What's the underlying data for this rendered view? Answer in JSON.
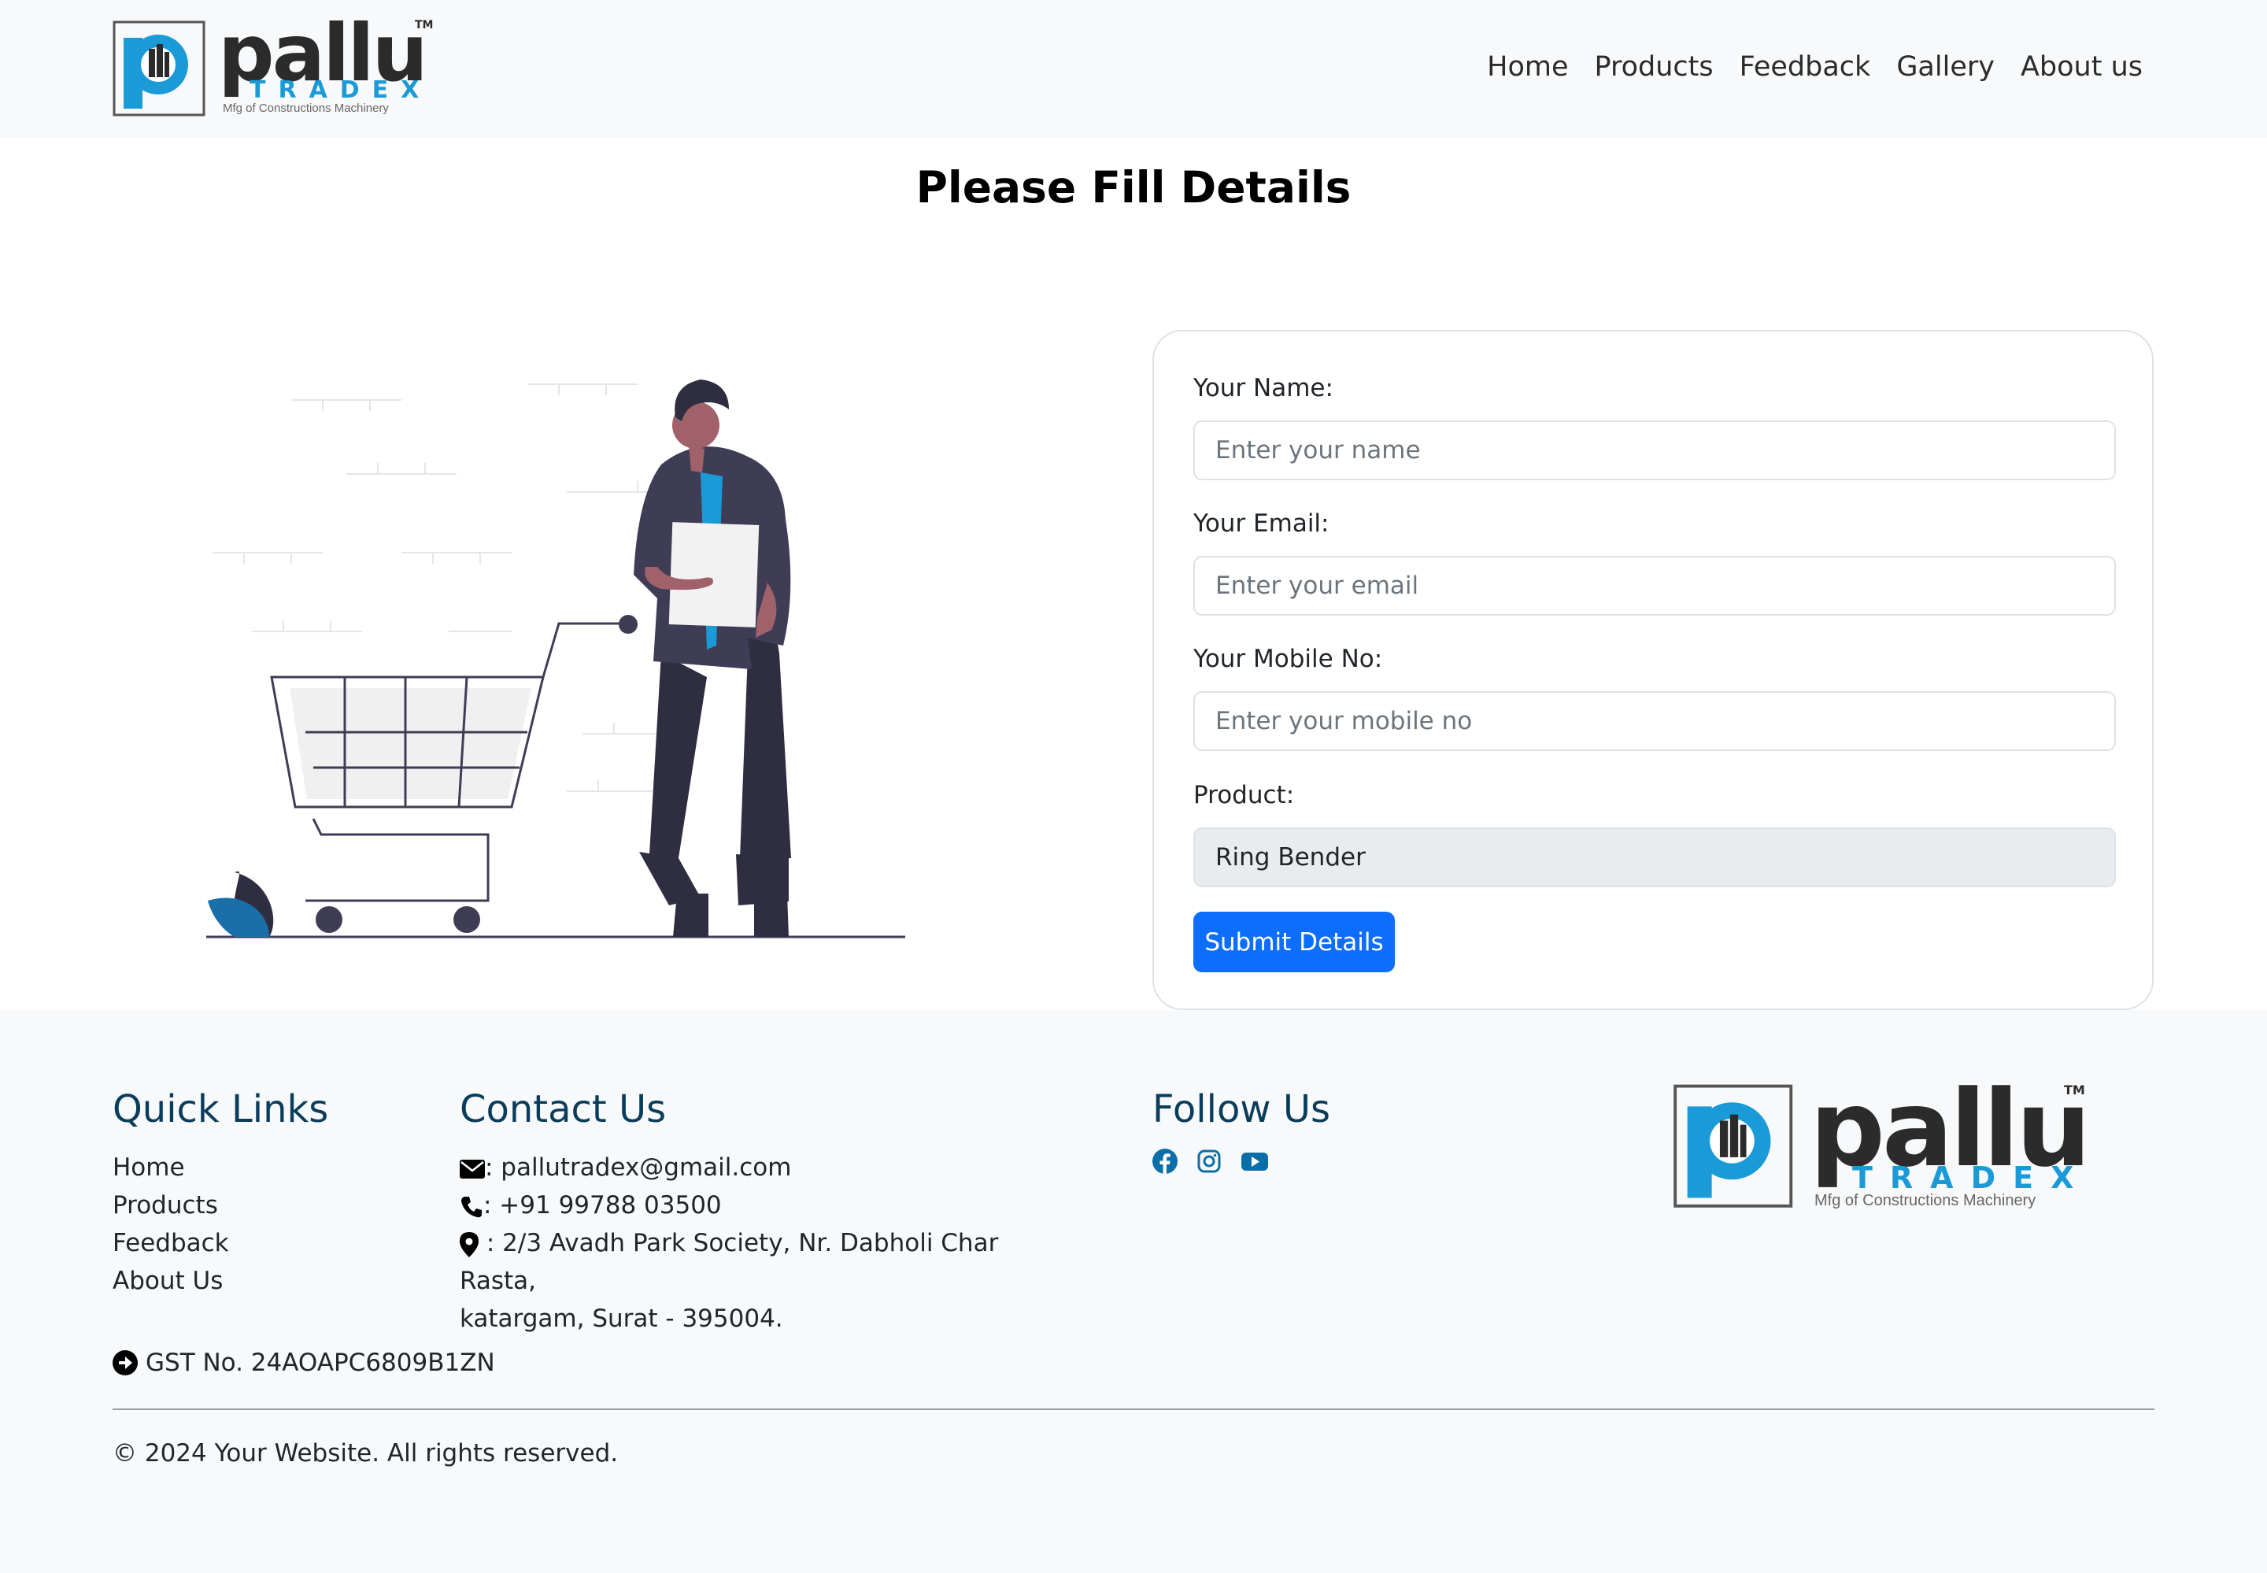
{
  "brand": {
    "name": "pallu",
    "tradex": "TRADEX",
    "tagline": "Mfg of Constructions Machinery",
    "tm": "TM"
  },
  "nav": {
    "items": [
      {
        "label": "Home"
      },
      {
        "label": "Products"
      },
      {
        "label": "Feedback"
      },
      {
        "label": "Gallery"
      },
      {
        "label": "About us"
      }
    ]
  },
  "page_title": "Please Fill Details",
  "form": {
    "name_label": "Your Name:",
    "name_placeholder": "Enter your name",
    "email_label": "Your Email:",
    "email_placeholder": "Enter your email",
    "mobile_label": "Your Mobile No:",
    "mobile_placeholder": "Enter your mobile no",
    "product_label": "Product:",
    "product_value": "Ring Bender",
    "submit_label": "Submit Details"
  },
  "footer": {
    "quick_links_heading": "Quick Links",
    "quick_links": [
      "Home",
      "Products",
      "Feedback",
      "About Us"
    ],
    "contact_heading": "Contact Us",
    "email": ": pallutradex@gmail.com",
    "phone": ": +91 99788 03500",
    "address_line1": ": 2/3 Avadh Park Society, Nr. Dabholi Char Rasta,",
    "address_line2": "katargam, Surat - 395004.",
    "follow_heading": "Follow Us",
    "gst": "GST No. 24AOAPC6809B1ZN",
    "copyright": "© 2024 Your Website. All rights reserved."
  },
  "colors": {
    "accent": "#0d6efd",
    "brand_blue": "#1a9ad6",
    "footer_heading": "#0a3d5c",
    "social": "#0a6fa8"
  },
  "icons": [
    "envelope-icon",
    "phone-icon",
    "map-marker-icon",
    "facebook-icon",
    "instagram-icon",
    "youtube-icon",
    "arrow-circle-right-icon"
  ]
}
